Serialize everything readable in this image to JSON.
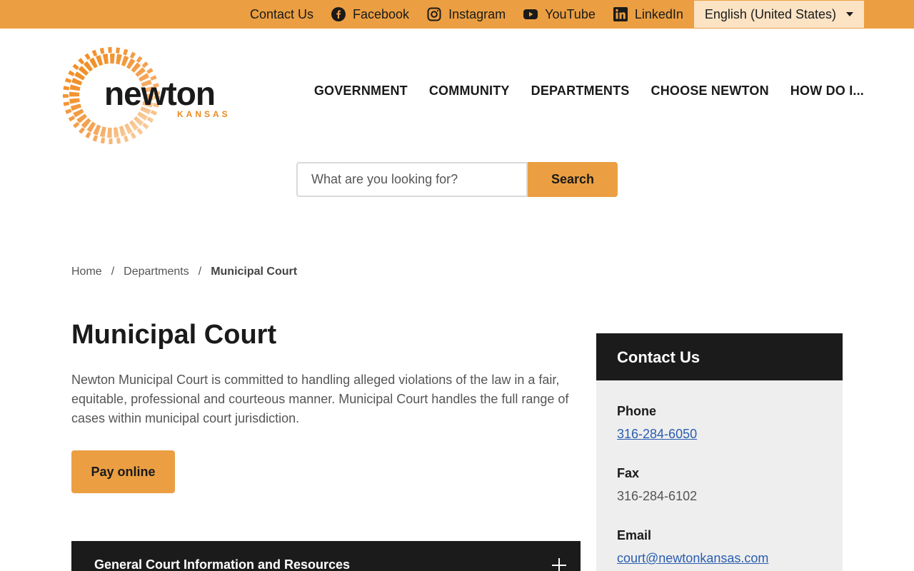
{
  "topbar": {
    "links": [
      {
        "label": "Contact Us",
        "icon": ""
      },
      {
        "label": "Facebook",
        "icon": "facebook-icon"
      },
      {
        "label": "Instagram",
        "icon": "instagram-icon"
      },
      {
        "label": "YouTube",
        "icon": "youtube-icon"
      },
      {
        "label": "LinkedIn",
        "icon": "linkedin-icon"
      }
    ],
    "language": "English (United States)"
  },
  "logo": {
    "word": "newton",
    "sub": "KANSAS"
  },
  "nav": {
    "items": [
      "GOVERNMENT",
      "COMMUNITY",
      "DEPARTMENTS",
      "CHOOSE NEWTON",
      "HOW DO I..."
    ]
  },
  "search": {
    "placeholder": "What are you looking for?",
    "button": "Search"
  },
  "breadcrumb": {
    "items": [
      "Home",
      "Departments"
    ],
    "current": "Municipal Court",
    "separator": "/"
  },
  "main": {
    "title": "Municipal Court",
    "intro": "Newton Municipal Court is committed to handling alleged violations of the law in a fair, equitable, professional and courteous manner. Municipal Court handles the full range of cases within municipal court jurisdiction.",
    "pay_button": "Pay online",
    "accordion_label": "General Court Information and Resources"
  },
  "contact": {
    "heading": "Contact Us",
    "phone_label": "Phone",
    "phone": "316-284-6050",
    "fax_label": "Fax",
    "fax": "316-284-6102",
    "email_label": "Email",
    "email": "court@newtonkansas.com"
  },
  "colors": {
    "accent": "#eb9f42",
    "dark": "#1c1b1c",
    "link": "#2a5db0"
  }
}
